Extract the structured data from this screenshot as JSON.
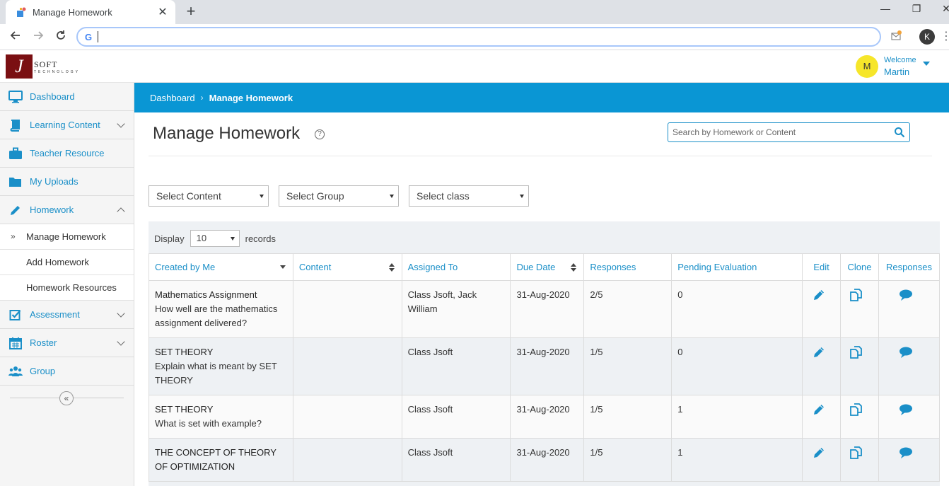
{
  "browser": {
    "tab_title": "Manage Homework",
    "tab_close": "✕",
    "new_tab": "+",
    "win_min": "—",
    "win_restore": "❐",
    "win_close": "✕",
    "address_value": "",
    "google_g": "G",
    "profile_initial": "K"
  },
  "header": {
    "logo_soft": "SOFT",
    "logo_tech": "TECHNOLOGY",
    "avatar_initial": "M",
    "welcome": "Welcome",
    "username": "Martin"
  },
  "sidebar": {
    "items": [
      {
        "label": "Dashboard",
        "icon": "monitor-icon"
      },
      {
        "label": "Learning Content",
        "icon": "book-icon",
        "chevron": "down"
      },
      {
        "label": "Teacher Resource",
        "icon": "briefcase-icon"
      },
      {
        "label": "My Uploads",
        "icon": "folder-icon"
      },
      {
        "label": "Homework",
        "icon": "pencil-icon",
        "chevron": "up"
      }
    ],
    "homework_sub": [
      {
        "label": "Manage Homework",
        "active": true
      },
      {
        "label": "Add Homework"
      },
      {
        "label": "Homework Resources"
      }
    ],
    "items_after": [
      {
        "label": "Assessment",
        "icon": "checkbox-icon",
        "chevron": "down"
      },
      {
        "label": "Roster",
        "icon": "calendar-icon",
        "chevron": "down"
      },
      {
        "label": "Group",
        "icon": "users-icon"
      }
    ],
    "collapse_symbol": "«"
  },
  "breadcrumb": {
    "home": "Dashboard",
    "separator": "›",
    "current": "Manage Homework"
  },
  "page": {
    "title": "Manage Homework",
    "help_symbol": "?",
    "search_placeholder": "Search by Homework or Content"
  },
  "filters": {
    "content": "Select Content",
    "group": "Select Group",
    "class": "Select class"
  },
  "table_controls": {
    "display_label": "Display",
    "display_value": "10",
    "records_label": "records"
  },
  "table": {
    "columns": [
      "Created by Me",
      "Content",
      "Assigned To",
      "Due Date",
      "Responses",
      "Pending Evaluation",
      "Edit",
      "Clone",
      "Responses"
    ],
    "rows": [
      {
        "title": "Mathematics Assignment",
        "desc": "How well are the mathematics assignment delivered?",
        "content": "",
        "assigned": "Class Jsoft, Jack William",
        "due": "31-Aug-2020",
        "responses": "2/5",
        "pending": "0"
      },
      {
        "title": "SET THEORY",
        "desc": "Explain what is meant by SET THEORY",
        "content": "",
        "assigned": "Class Jsoft",
        "due": "31-Aug-2020",
        "responses": "1/5",
        "pending": "0"
      },
      {
        "title": "SET THEORY",
        "desc": "What is set with example?",
        "content": "",
        "assigned": "Class Jsoft",
        "due": "31-Aug-2020",
        "responses": "1/5",
        "pending": "1"
      },
      {
        "title": "THE CONCEPT OF THEORY OF OPTIMIZATION",
        "desc": "",
        "content": "",
        "assigned": "Class Jsoft",
        "due": "31-Aug-2020",
        "responses": "1/5",
        "pending": "1"
      }
    ]
  },
  "colors": {
    "accent": "#1a8fc8",
    "breadcrumb_bg": "#0a96d4",
    "logo_bg": "#7a0f12",
    "avatar_bg": "#f6e62a"
  }
}
